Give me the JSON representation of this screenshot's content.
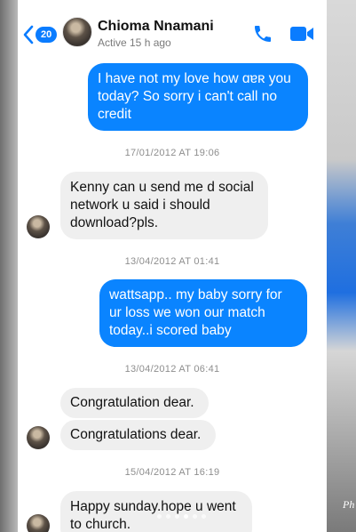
{
  "header": {
    "back_badge": "20",
    "contact_name": "Chioma Nnamani",
    "status": "Active 15 h ago",
    "icons": {
      "back": "chevron-left-icon",
      "call": "phone-icon",
      "video": "video-camera-icon"
    }
  },
  "messages": {
    "m1": "I have not my love how ɑɐʀ you today? So sorry i can't call no credit",
    "t1": "17/01/2012 AT 19:06",
    "m2": "Kenny can u send me d social network u said i should download?pls.",
    "t2": "13/04/2012 AT 01:41",
    "m3": "wattsapp..  my baby sorry for ur loss we won our match today..i scored baby",
    "t3": "13/04/2012 AT 06:41",
    "m4": "Congratulation dear.",
    "m5": "Congratulations dear.",
    "t4": "15/04/2012 AT 16:19",
    "m6": "Happy sunday.hope u went to church."
  },
  "background_text": "Ph",
  "colors": {
    "accent": "#0a84ff",
    "incoming": "#efefef"
  }
}
